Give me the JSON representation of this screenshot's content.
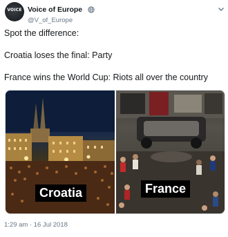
{
  "author": {
    "display_name": "Voice of Europe",
    "handle": "@V_of_Europe",
    "avatar_text": "VOICE",
    "verified_icon": "globe-icon"
  },
  "tweet": {
    "lines": [
      "Spot the difference:",
      "Croatia loses the final: Party",
      "France wins the World Cup: Riots all over the country"
    ]
  },
  "media": {
    "left_label": "Croatia",
    "right_label": "France"
  },
  "timestamp": "1:29 am · 16 Jul 2018",
  "colors": {
    "text": "#14171a",
    "secondary": "#657786",
    "border": "#e1e8ed"
  }
}
